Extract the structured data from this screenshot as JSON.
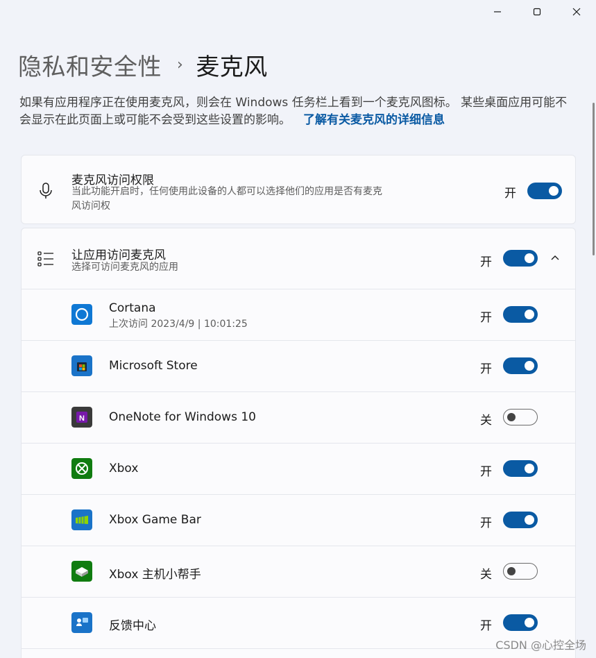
{
  "window": {
    "minimize_icon": "minimize-icon",
    "maximize_icon": "maximize-icon",
    "close_icon": "close-icon"
  },
  "breadcrumb": {
    "parent": "隐私和安全性",
    "separator": "›",
    "current": "麦克风"
  },
  "description": {
    "text": "如果有应用程序正在使用麦克风，则会在 Windows 任务栏上看到一个麦克风图标。 某些桌面应用可能不会显示在此页面上或可能不会受到这些设置的影响。",
    "link": "了解有关麦克风的详细信息"
  },
  "mic_access": {
    "icon": "microphone-icon",
    "title": "麦克风访问权限",
    "subtitle_line1": "当此功能开启时，任何使用此设备的人都可以选择他们的应用是否有麦克",
    "subtitle_line2": "风访问权",
    "state": "开",
    "on": true
  },
  "app_access": {
    "icon": "list-icon",
    "title": "让应用访问麦克风",
    "subtitle": "选择可访问麦克风的应用",
    "state": "开",
    "on": true,
    "expanded": true
  },
  "apps": [
    {
      "name": "Cortana",
      "sub": "上次访问 2023/4/9  |  10:01:25",
      "state": "开",
      "on": true,
      "icon": "cortana-icon",
      "color": "#0f78d4"
    },
    {
      "name": "Microsoft Store",
      "sub": "",
      "state": "开",
      "on": true,
      "icon": "microsoft-store-icon",
      "color": "#1a73c8"
    },
    {
      "name": "OneNote for Windows 10",
      "sub": "",
      "state": "关",
      "on": false,
      "icon": "onenote-icon",
      "color": "#3a3a3a"
    },
    {
      "name": "Xbox",
      "sub": "",
      "state": "开",
      "on": true,
      "icon": "xbox-icon",
      "color": "#107c10"
    },
    {
      "name": "Xbox Game Bar",
      "sub": "",
      "state": "开",
      "on": true,
      "icon": "xbox-game-bar-icon",
      "color": "#1a73c8"
    },
    {
      "name": "Xbox 主机小帮手",
      "sub": "",
      "state": "关",
      "on": false,
      "icon": "xbox-console-companion-icon",
      "color": "#107c10"
    },
    {
      "name": "反馈中心",
      "sub": "",
      "state": "开",
      "on": true,
      "icon": "feedback-hub-icon",
      "color": "#1a73c8"
    }
  ],
  "watermark": "CSDN @心控全场",
  "colors": {
    "accent": "#0a5aa3",
    "link": "#0a5aa3"
  }
}
